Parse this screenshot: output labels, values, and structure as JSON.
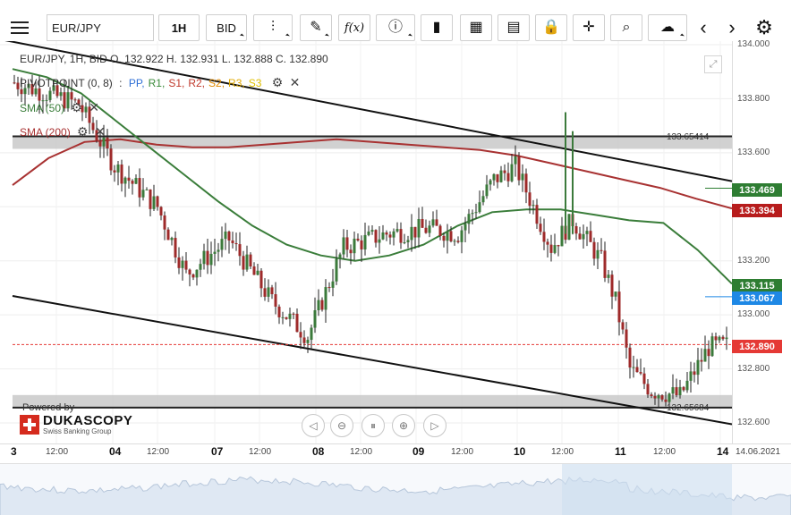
{
  "toolbar": {
    "menu_icon": "hamburger-icon",
    "symbol": "EUR/JPY",
    "timeframe": "1H",
    "price_type": "BID",
    "items": [
      {
        "name": "chart-type-icon",
        "glyph": "⫶"
      },
      {
        "name": "draw-pen-icon",
        "glyph": "✎"
      },
      {
        "name": "formula-icon",
        "glyph": "f(x)"
      },
      {
        "name": "info-icon",
        "glyph": "ⓘ"
      },
      {
        "name": "bar-chart-icon",
        "glyph": "▮"
      },
      {
        "name": "calendar-icon",
        "glyph": "▦"
      },
      {
        "name": "news-icon",
        "glyph": "▤"
      },
      {
        "name": "lock-icon",
        "glyph": "🔒"
      },
      {
        "name": "crosshair-icon",
        "glyph": "✛"
      },
      {
        "name": "zoom-icon",
        "glyph": "⌕"
      },
      {
        "name": "cloud-icon",
        "glyph": "☁"
      },
      {
        "name": "prev-arrow-icon",
        "glyph": "‹"
      },
      {
        "name": "next-arrow-icon",
        "glyph": "›"
      },
      {
        "name": "settings-gear-icon",
        "glyph": "⚙"
      }
    ]
  },
  "legend": {
    "ohlc": "EUR/JPY, 1H, BID   O. 132.922 H. 132.931 L. 132.888 C. 132.890",
    "pivot_name": "PIVOTPOINT (0, 8)",
    "pivot_levels": [
      {
        "label": "PP,",
        "color": "#2f6fd6"
      },
      {
        "label": "R1,",
        "color": "#3a8a3a"
      },
      {
        "label": "S1,",
        "color": "#c0392b"
      },
      {
        "label": "R2,",
        "color": "#c0392b"
      },
      {
        "label": "S2,",
        "color": "#e08a00"
      },
      {
        "label": "R3,",
        "color": "#e0a800"
      },
      {
        "label": "S3",
        "color": "#e0c000"
      }
    ],
    "pivot_sep": ":",
    "sma50": "SMA (50)",
    "sma200": "SMA (200)"
  },
  "price_axis": {
    "labels": [
      "134.000",
      "133.800",
      "133.600",
      "133.200",
      "133.000",
      "132.800",
      "132.600"
    ],
    "tags": [
      {
        "value": "133.469",
        "color": "#2e7d32"
      },
      {
        "value": "133.394",
        "color": "#b71c1c"
      },
      {
        "value": "133.115",
        "color": "#2e7d32"
      },
      {
        "value": "133.067",
        "color": "#1e88e5"
      },
      {
        "value": "132.890",
        "color": "#e53935"
      }
    ]
  },
  "bands": {
    "upper_label": "133.65414",
    "lower_label": "132.65684"
  },
  "time_axis": {
    "labels": [
      {
        "text": "3",
        "bold": true
      },
      {
        "text": "12:00",
        "bold": false
      },
      {
        "text": "04",
        "bold": true
      },
      {
        "text": "12:00",
        "bold": false
      },
      {
        "text": "07",
        "bold": true
      },
      {
        "text": "12:00",
        "bold": false
      },
      {
        "text": "08",
        "bold": true
      },
      {
        "text": "12:00",
        "bold": false
      },
      {
        "text": "09",
        "bold": true
      },
      {
        "text": "12:00",
        "bold": false
      },
      {
        "text": "10",
        "bold": true
      },
      {
        "text": "12:00",
        "bold": false
      },
      {
        "text": "11",
        "bold": true
      },
      {
        "text": "12:00",
        "bold": false
      },
      {
        "text": "14",
        "bold": true
      },
      {
        "text": "14.06.2021",
        "bold": false
      }
    ]
  },
  "branding": {
    "powered_by": "Powered by",
    "name": "DUKASCOPY",
    "tagline": "Swiss Banking Group"
  },
  "nav_controls": [
    {
      "name": "scroll-left-icon",
      "glyph": "◁"
    },
    {
      "name": "zoom-out-icon",
      "glyph": "⊖"
    },
    {
      "name": "reset-icon",
      "glyph": "⏸"
    },
    {
      "name": "zoom-in-icon",
      "glyph": "⊕"
    },
    {
      "name": "scroll-right-icon",
      "glyph": "▷"
    }
  ],
  "chart_data": {
    "type": "candlestick",
    "title": "EUR/JPY, 1H, BID",
    "ylim": [
      132.55,
      134.0
    ],
    "last_close": 132.89,
    "series": [
      {
        "name": "SMA (50)",
        "color": "#3a7d3a",
        "values": [
          133.91,
          133.88,
          133.82,
          133.72,
          133.62,
          133.52,
          133.42,
          133.33,
          133.26,
          133.22,
          133.2,
          133.22,
          133.26,
          133.33,
          133.38,
          133.39,
          133.39,
          133.37,
          133.35,
          133.34,
          133.24,
          133.115
        ]
      },
      {
        "name": "SMA (200)",
        "color": "#a83232",
        "values": [
          133.48,
          133.58,
          133.64,
          133.65,
          133.63,
          133.62,
          133.62,
          133.63,
          133.64,
          133.65,
          133.64,
          133.63,
          133.62,
          133.61,
          133.59,
          133.56,
          133.53,
          133.5,
          133.47,
          133.43,
          133.394
        ]
      },
      {
        "name": "PP",
        "values": [
          133.067
        ]
      },
      {
        "name": "Upper channel",
        "values": [
          134.02,
          133.469
        ]
      },
      {
        "name": "Lower channel",
        "values": [
          133.07,
          132.59
        ]
      }
    ],
    "horizontal_bands": [
      133.65414,
      132.65684
    ],
    "candles": [
      [
        133.86,
        133.92,
        133.8,
        133.84
      ],
      [
        133.84,
        133.88,
        133.78,
        133.82
      ],
      [
        133.82,
        133.9,
        133.76,
        133.8
      ],
      [
        133.8,
        133.86,
        133.74,
        133.83
      ],
      [
        133.83,
        133.88,
        133.7,
        133.72
      ],
      [
        133.72,
        133.8,
        133.66,
        133.78
      ],
      [
        133.78,
        133.85,
        133.72,
        133.76
      ],
      [
        133.76,
        133.8,
        133.64,
        133.66
      ],
      [
        133.66,
        133.7,
        133.52,
        133.56
      ],
      [
        133.56,
        133.62,
        133.48,
        133.58
      ],
      [
        133.58,
        133.6,
        133.42,
        133.46
      ],
      [
        133.46,
        133.5,
        133.36,
        133.4
      ],
      [
        133.4,
        133.44,
        133.3,
        133.34
      ],
      [
        133.34,
        133.4,
        133.26,
        133.36
      ],
      [
        133.36,
        133.58,
        133.3,
        133.52
      ],
      [
        133.52,
        133.56,
        133.1,
        133.16
      ],
      [
        133.16,
        133.24,
        133.06,
        133.2
      ],
      [
        133.2,
        133.26,
        133.08,
        133.12
      ],
      [
        133.12,
        133.38,
        133.1,
        133.34
      ],
      [
        133.34,
        133.38,
        133.16,
        133.18
      ],
      [
        133.18,
        133.3,
        133.12,
        133.28
      ],
      [
        133.28,
        133.34,
        133.04,
        133.08
      ],
      [
        133.08,
        133.14,
        132.92,
        132.96
      ],
      [
        133.96,
        133.96,
        133.96,
        133.96
      ]
    ]
  }
}
